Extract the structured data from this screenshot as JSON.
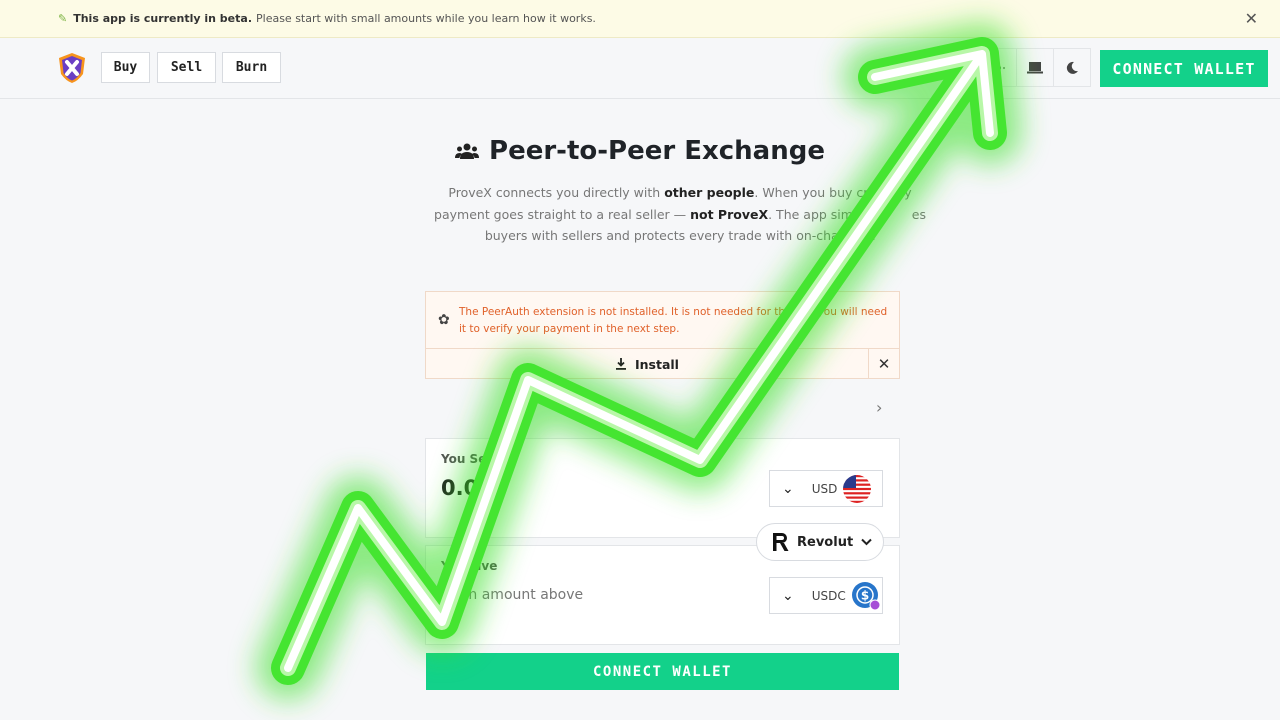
{
  "beta_banner": {
    "bold": "This app is currently in beta.",
    "text": "Please start with small amounts while you learn how it works.",
    "close": "✕"
  },
  "nav": {
    "buy": "Buy",
    "sell": "Sell",
    "burn": "Burn",
    "connect_wallet": "CONNECT WALLET"
  },
  "hero": {
    "title": "Peer-to-Peer Exchange",
    "desc_1": "ProveX connects you directly with ",
    "desc_bold_1": "other people",
    "desc_2": ". When you buy crypto, y",
    "desc_3": "payment goes straight to a real seller — ",
    "desc_bold_2": "not ProveX",
    "desc_4": ". The app simply m",
    "desc_5": "es",
    "desc_6": "buyers with sellers and protects every trade with on-chain esc"
  },
  "extension_notice": {
    "message": "The PeerAuth extension is not installed. It is not needed for this         but you will need it to verify your payment in the next step.",
    "install": "Install",
    "dismiss": "✕"
  },
  "send": {
    "label": "You Sen",
    "amount": "0.00",
    "currency": "USD"
  },
  "receive": {
    "label": "Y    eceive",
    "placeholder": "er an amount above",
    "currency": "USDC"
  },
  "payment_method": {
    "name": "Revolut"
  },
  "bottom": {
    "connect_wallet": "CONNECT WALLET"
  },
  "colors": {
    "accent": "#13d18a",
    "warning": "#e0612a",
    "arrow_glow": "#3ddc2a"
  }
}
